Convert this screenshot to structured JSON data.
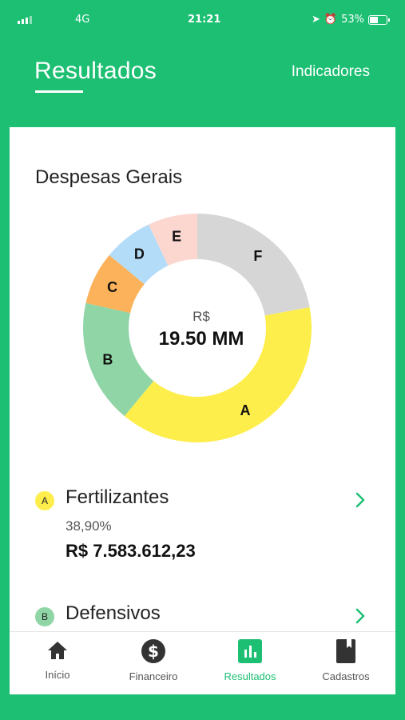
{
  "status_bar": {
    "network": "4G",
    "time": "21:21",
    "battery": "53%"
  },
  "header": {
    "tabs": [
      {
        "label": "Resultados",
        "active": true
      },
      {
        "label": "Indicadores",
        "active": false
      }
    ]
  },
  "section": {
    "title": "Despesas Gerais"
  },
  "chart_center": {
    "currency": "R$",
    "value": "19.50 MM"
  },
  "chart_data": {
    "type": "pie",
    "categories": [
      "A",
      "B",
      "C",
      "D",
      "E",
      "F"
    ],
    "values": [
      38.9,
      17.5,
      7.5,
      7.0,
      7.0,
      22.1
    ],
    "colors": [
      "#fdee4b",
      "#8fd5a6",
      "#fbb25a",
      "#b3dcf9",
      "#fbd7cf",
      "#d6d6d6"
    ]
  },
  "items": [
    {
      "letter": "A",
      "name": "Fertilizantes",
      "percent": "38,90%",
      "value": "R$ 7.583.612,23",
      "color": "#fdee4b"
    },
    {
      "letter": "B",
      "name": "Defensivos",
      "color": "#8fd5a6"
    }
  ],
  "bottom_nav": [
    {
      "label": "Início",
      "icon": "home-icon",
      "active": false
    },
    {
      "label": "Financeiro",
      "icon": "dollar-icon",
      "active": false
    },
    {
      "label": "Resultados",
      "icon": "bar-chart-icon",
      "active": true
    },
    {
      "label": "Cadastros",
      "icon": "book-icon",
      "active": false
    }
  ]
}
